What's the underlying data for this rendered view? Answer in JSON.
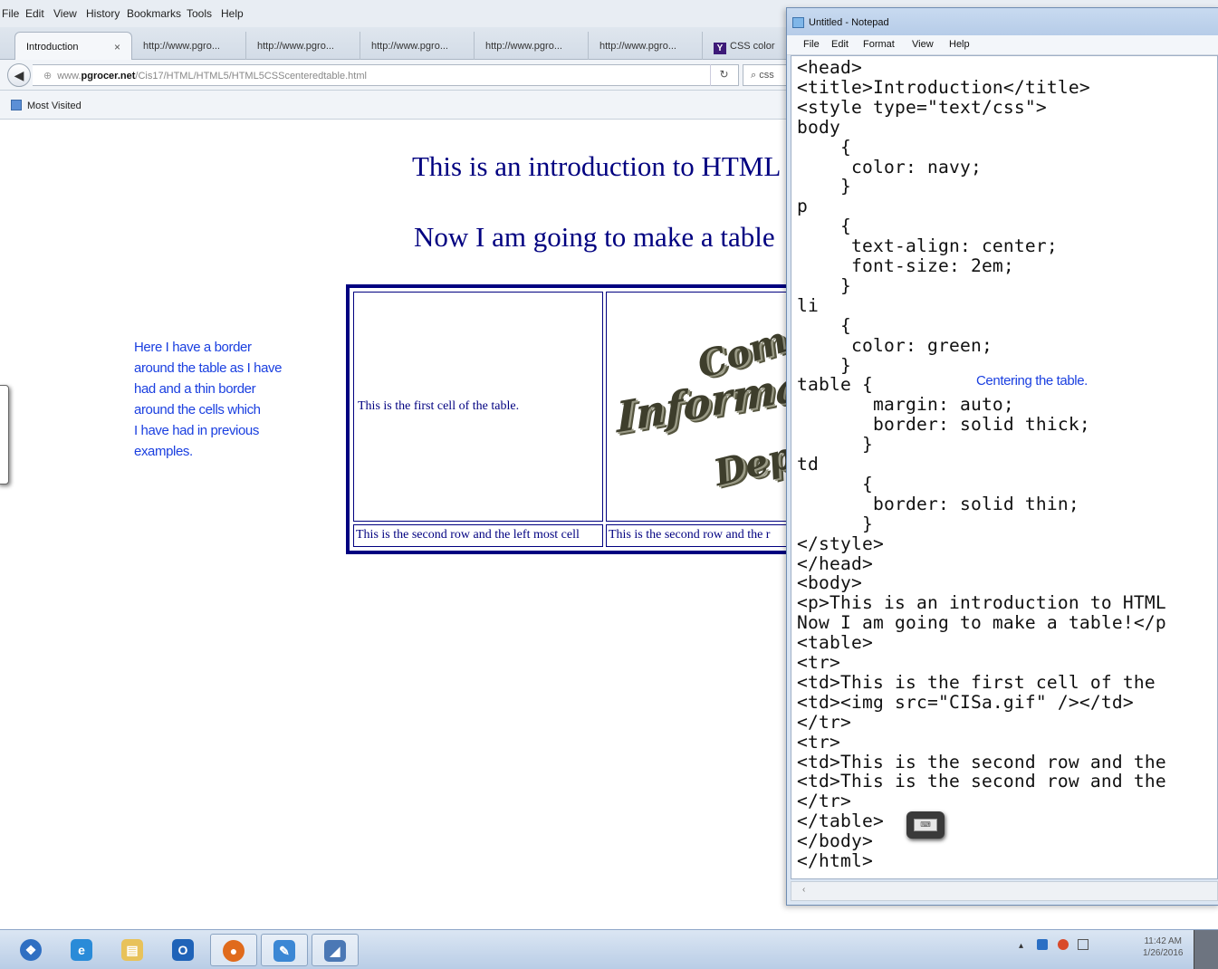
{
  "browser": {
    "menu": [
      "File",
      "Edit",
      "View",
      "History",
      "Bookmarks",
      "Tools",
      "Help"
    ],
    "tabs": [
      {
        "label": "Introduction",
        "close": "×"
      },
      {
        "label": "http://www.pgro..."
      },
      {
        "label": "http://www.pgro..."
      },
      {
        "label": "http://www.pgro..."
      },
      {
        "label": "http://www.pgro..."
      },
      {
        "label": "http://www.pgro..."
      },
      {
        "label": "CSS color"
      }
    ],
    "url_prefix": "www.",
    "url_host": "pgrocer.net",
    "url_path": "/Cis17/HTML/HTML5/HTML5CSScenteredtable.html",
    "reload_icon": "↻",
    "search_text": "css",
    "bookmark_label": "Most Visited"
  },
  "page": {
    "line1": "This is an introduction to HTML",
    "line2": "Now I am going to make a table",
    "annotation": [
      "Here I have a border",
      "around the table as I have",
      "had and a thin border",
      "around the cells which",
      "I have had in previous",
      "examples."
    ],
    "cell1": "This is the first cell of the table.",
    "cell3": "This is the second row and the left most cell",
    "cell4": "This is the second row and the r",
    "logo_words": [
      "Computer",
      "Information S",
      "Departme"
    ]
  },
  "notepad": {
    "title": "Untitled - Notepad",
    "menu": [
      "File",
      "Edit",
      "Format",
      "View",
      "Help"
    ],
    "note": "Centering the table.",
    "scroll_arrow": "‹",
    "code": [
      "<head>",
      "<title>Introduction</title>",
      "<style type=\"text/css\">",
      "body",
      "    {",
      "     color: navy;",
      "    }",
      "p",
      "    {",
      "     text-align: center;",
      "     font-size: 2em;",
      "    }",
      "li",
      "    {",
      "     color: green;",
      "    }",
      "table {",
      "       margin: auto;",
      "       border: solid thick;",
      "      }",
      "td",
      "      {",
      "       border: solid thin;",
      "      }",
      "</style>",
      "</head>",
      "<body>",
      "<p>This is an introduction to HTML",
      "Now I am going to make a table!</p",
      "<table>",
      "<tr>",
      "<td>This is the first cell of the",
      "<td><img src=\"CISa.gif\" /></td>",
      "</tr>",
      "<tr>",
      "<td>This is the second row and the",
      "<td>This is the second row and the",
      "</tr>",
      "</table>",
      "</body>",
      "</html>"
    ]
  },
  "taskbar": {
    "items": [
      {
        "name": "start-orb-icon",
        "glyph": "❖",
        "color": "#2f6fc2"
      },
      {
        "name": "internet-explorer-icon",
        "glyph": "e",
        "color": "#2a8bd8"
      },
      {
        "name": "file-explorer-icon",
        "glyph": "▤",
        "color": "#e8c25a"
      },
      {
        "name": "outlook-icon",
        "glyph": "O",
        "color": "#1f63b8"
      },
      {
        "name": "firefox-icon",
        "glyph": "●",
        "color": "#e06b1c"
      },
      {
        "name": "notepad-app-icon",
        "glyph": "✎",
        "color": "#3b87d4"
      },
      {
        "name": "window-app-icon",
        "glyph": "◢",
        "color": "#4b78b5"
      }
    ],
    "time": "11:42 AM",
    "date": "1/26/2016",
    "tray": "▴"
  }
}
